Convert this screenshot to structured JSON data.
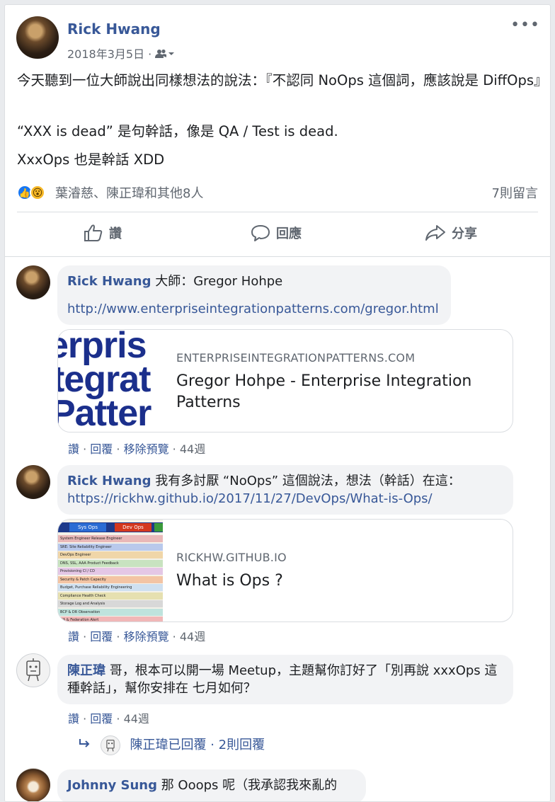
{
  "post": {
    "author": "Rick Hwang",
    "date": "2018年3月5日 ·",
    "audience_icon": "friends-icon",
    "more_label": "•••",
    "paragraphs": [
      "今天聽到一位大師說出同樣想法的說法：『不認同 NoOps 這個詞，應該說是 DiffOps』",
      "“XXX is dead” 是句幹話，像是 QA / Test is dead.",
      "XxxOps 也是幹話 XDD"
    ],
    "reactions": {
      "icons": [
        "like-icon",
        "wow-icon"
      ],
      "like_glyph": "👍",
      "wow_glyph": "😮",
      "reactors": "葉濬慈、陳正瑋和其他8人",
      "comment_count": "7則留言"
    },
    "actions": {
      "like": "讚",
      "comment": "回應",
      "share": "分享"
    }
  },
  "comments": [
    {
      "author": "Rick Hwang",
      "text": " 大師：Gregor Hohpe",
      "link": "http://www.enterpriseintegrationpatterns.com/gregor.html",
      "preview": {
        "domain": "ENTERPRISEINTEGRATIONPATTERNS.COM",
        "title": "Gregor Hohpe - Enterprise Integration Patterns",
        "thumb_lines": [
          "erpris",
          "tegrat",
          "Patter"
        ]
      },
      "meta": {
        "like": "讚",
        "reply": "回覆",
        "remove": "移除預覽",
        "age": "44週"
      }
    },
    {
      "author": "Rick Hwang",
      "text": " 我有多討厭 “NoOps” 這個說法，想法（幹話）在這：",
      "link": "https://rickhw.github.io/2017/11/27/DevOps/What-is-Ops/",
      "preview": {
        "domain": "RICKHW.GITHUB.IO",
        "title": "What is Ops ?",
        "thumb_header": [
          "Sys Ops",
          "Dev Ops"
        ],
        "thumb_rows": [
          "System Engineer   Release Engineer",
          "SRE: Site Reliability Engineer",
          "DevOps Engineer",
          "DNS, SSL, AAA   Product Feedback",
          "Provisioning   CI / CD",
          "Security & Patch   Capacity",
          "Budget, Purchase   Reliability Engineering",
          "Compliance   Health Check",
          "Storage   Log and Analysis",
          "BCP & DR   Observation",
          "HA & Federation   Alert"
        ]
      },
      "meta": {
        "like": "讚",
        "reply": "回覆",
        "remove": "移除預覽",
        "age": "44週"
      }
    },
    {
      "author": "陳正瑋",
      "text": " 哥，根本可以開一場 Meetup，主題幫你訂好了「別再說 xxxOps 這種幹話」，幫你安排在 七月如何？",
      "meta": {
        "like": "讚",
        "reply": "回覆",
        "age": "44週"
      },
      "replies": {
        "text": "陳正瑋已回覆 · 2則回覆"
      }
    },
    {
      "author": "Johnny Sung",
      "text": " 那 Ooops 呢（我承認我來亂的"
    }
  ],
  "colors": {
    "link": "#385898",
    "muted": "#606770",
    "bubble": "#f2f3f5",
    "like": "#1877f2",
    "wow": "#f7b928"
  }
}
